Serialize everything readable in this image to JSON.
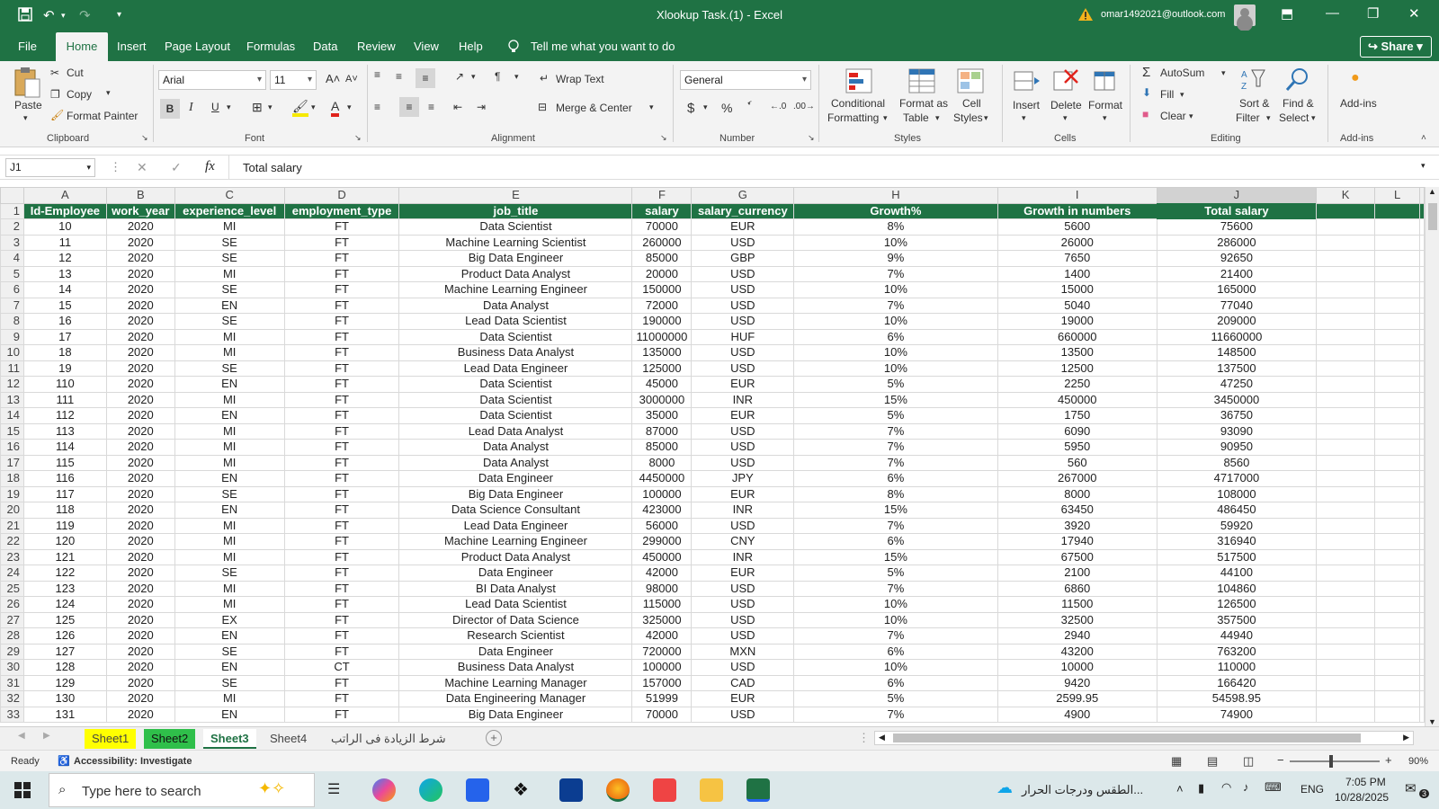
{
  "window": {
    "title": "Xlookup Task.(1)  -  Excel",
    "account": "omar1492021@outlook.com"
  },
  "menu": {
    "tabs": [
      "File",
      "Home",
      "Insert",
      "Page Layout",
      "Formulas",
      "Data",
      "Review",
      "View",
      "Help"
    ],
    "active": "Home",
    "tell_me": "Tell me what you want to do",
    "share": "Share"
  },
  "ribbon": {
    "clipboard": {
      "paste": "Paste",
      "cut": "Cut",
      "copy": "Copy",
      "format_painter": "Format Painter",
      "group": "Clipboard"
    },
    "font": {
      "name": "Arial",
      "size": "11",
      "group": "Font"
    },
    "alignment": {
      "wrap": "Wrap Text",
      "merge": "Merge & Center",
      "group": "Alignment"
    },
    "number": {
      "format": "General",
      "group": "Number",
      "currency": "$",
      "percent": "%",
      "comma": "ٗ"
    },
    "styles": {
      "conditional_1": "Conditional",
      "conditional_2": "Formatting",
      "format_table_1": "Format as",
      "format_table_2": "Table",
      "cell_styles_1": "Cell",
      "cell_styles_2": "Styles",
      "group": "Styles"
    },
    "cells": {
      "insert": "Insert",
      "delete": "Delete",
      "format": "Format",
      "group": "Cells"
    },
    "editing": {
      "autosum": "AutoSum",
      "fill": "Fill",
      "clear": "Clear",
      "sort_1": "Sort &",
      "sort_2": "Filter",
      "find_1": "Find &",
      "find_2": "Select",
      "group": "Editing"
    },
    "addins": {
      "label": "Add-ins",
      "group": "Add-ins"
    }
  },
  "formula_bar": {
    "name_box": "J1",
    "content": "Total salary",
    "fx": "fx"
  },
  "grid": {
    "columns": [
      "A",
      "B",
      "C",
      "D",
      "E",
      "F",
      "G",
      "H",
      "I",
      "J",
      "K",
      "L"
    ],
    "selected_cell": "J1",
    "header": [
      "Id-Employee",
      "work_year",
      "experience_level",
      "employment_type",
      "job_title",
      "salary",
      "salary_currency",
      "Growth%",
      "Growth in numbers",
      "Total salary"
    ],
    "rows": [
      [
        "10",
        "2020",
        "MI",
        "FT",
        "Data Scientist",
        "70000",
        "EUR",
        "8%",
        "5600",
        "75600"
      ],
      [
        "11",
        "2020",
        "SE",
        "FT",
        "Machine Learning Scientist",
        "260000",
        "USD",
        "10%",
        "26000",
        "286000"
      ],
      [
        "12",
        "2020",
        "SE",
        "FT",
        "Big Data Engineer",
        "85000",
        "GBP",
        "9%",
        "7650",
        "92650"
      ],
      [
        "13",
        "2020",
        "MI",
        "FT",
        "Product Data Analyst",
        "20000",
        "USD",
        "7%",
        "1400",
        "21400"
      ],
      [
        "14",
        "2020",
        "SE",
        "FT",
        "Machine Learning Engineer",
        "150000",
        "USD",
        "10%",
        "15000",
        "165000"
      ],
      [
        "15",
        "2020",
        "EN",
        "FT",
        "Data Analyst",
        "72000",
        "USD",
        "7%",
        "5040",
        "77040"
      ],
      [
        "16",
        "2020",
        "SE",
        "FT",
        "Lead Data Scientist",
        "190000",
        "USD",
        "10%",
        "19000",
        "209000"
      ],
      [
        "17",
        "2020",
        "MI",
        "FT",
        "Data Scientist",
        "11000000",
        "HUF",
        "6%",
        "660000",
        "11660000"
      ],
      [
        "18",
        "2020",
        "MI",
        "FT",
        "Business Data Analyst",
        "135000",
        "USD",
        "10%",
        "13500",
        "148500"
      ],
      [
        "19",
        "2020",
        "SE",
        "FT",
        "Lead Data Engineer",
        "125000",
        "USD",
        "10%",
        "12500",
        "137500"
      ],
      [
        "110",
        "2020",
        "EN",
        "FT",
        "Data Scientist",
        "45000",
        "EUR",
        "5%",
        "2250",
        "47250"
      ],
      [
        "111",
        "2020",
        "MI",
        "FT",
        "Data Scientist",
        "3000000",
        "INR",
        "15%",
        "450000",
        "3450000"
      ],
      [
        "112",
        "2020",
        "EN",
        "FT",
        "Data Scientist",
        "35000",
        "EUR",
        "5%",
        "1750",
        "36750"
      ],
      [
        "113",
        "2020",
        "MI",
        "FT",
        "Lead Data Analyst",
        "87000",
        "USD",
        "7%",
        "6090",
        "93090"
      ],
      [
        "114",
        "2020",
        "MI",
        "FT",
        "Data Analyst",
        "85000",
        "USD",
        "7%",
        "5950",
        "90950"
      ],
      [
        "115",
        "2020",
        "MI",
        "FT",
        "Data Analyst",
        "8000",
        "USD",
        "7%",
        "560",
        "8560"
      ],
      [
        "116",
        "2020",
        "EN",
        "FT",
        "Data Engineer",
        "4450000",
        "JPY",
        "6%",
        "267000",
        "4717000"
      ],
      [
        "117",
        "2020",
        "SE",
        "FT",
        "Big Data Engineer",
        "100000",
        "EUR",
        "8%",
        "8000",
        "108000"
      ],
      [
        "118",
        "2020",
        "EN",
        "FT",
        "Data Science Consultant",
        "423000",
        "INR",
        "15%",
        "63450",
        "486450"
      ],
      [
        "119",
        "2020",
        "MI",
        "FT",
        "Lead Data Engineer",
        "56000",
        "USD",
        "7%",
        "3920",
        "59920"
      ],
      [
        "120",
        "2020",
        "MI",
        "FT",
        "Machine Learning Engineer",
        "299000",
        "CNY",
        "6%",
        "17940",
        "316940"
      ],
      [
        "121",
        "2020",
        "MI",
        "FT",
        "Product Data Analyst",
        "450000",
        "INR",
        "15%",
        "67500",
        "517500"
      ],
      [
        "122",
        "2020",
        "SE",
        "FT",
        "Data Engineer",
        "42000",
        "EUR",
        "5%",
        "2100",
        "44100"
      ],
      [
        "123",
        "2020",
        "MI",
        "FT",
        "BI Data Analyst",
        "98000",
        "USD",
        "7%",
        "6860",
        "104860"
      ],
      [
        "124",
        "2020",
        "MI",
        "FT",
        "Lead Data Scientist",
        "115000",
        "USD",
        "10%",
        "11500",
        "126500"
      ],
      [
        "125",
        "2020",
        "EX",
        "FT",
        "Director of Data Science",
        "325000",
        "USD",
        "10%",
        "32500",
        "357500"
      ],
      [
        "126",
        "2020",
        "EN",
        "FT",
        "Research Scientist",
        "42000",
        "USD",
        "7%",
        "2940",
        "44940"
      ],
      [
        "127",
        "2020",
        "SE",
        "FT",
        "Data Engineer",
        "720000",
        "MXN",
        "6%",
        "43200",
        "763200"
      ],
      [
        "128",
        "2020",
        "EN",
        "CT",
        "Business Data Analyst",
        "100000",
        "USD",
        "10%",
        "10000",
        "110000"
      ],
      [
        "129",
        "2020",
        "SE",
        "FT",
        "Machine Learning Manager",
        "157000",
        "CAD",
        "6%",
        "9420",
        "166420"
      ],
      [
        "130",
        "2020",
        "MI",
        "FT",
        "Data Engineering Manager",
        "51999",
        "EUR",
        "5%",
        "2599.95",
        "54598.95"
      ],
      [
        "131",
        "2020",
        "EN",
        "FT",
        "Big Data Engineer",
        "70000",
        "USD",
        "7%",
        "4900",
        "74900"
      ]
    ]
  },
  "sheets": {
    "tabs": [
      "Sheet1",
      "Sheet2",
      "Sheet3",
      "Sheet4",
      "شرط الزيادة فى الراتب"
    ],
    "active": "Sheet3",
    "colors": {
      "Sheet1": "#ffff00",
      "Sheet2": "#2fbf4a"
    }
  },
  "status": {
    "ready": "Ready",
    "accessibility": "Accessibility: Investigate",
    "zoom": "90%"
  },
  "taskbar": {
    "search_placeholder": "Type here to search",
    "weather": "الطقس ودرجات الحرار...",
    "language": "ENG",
    "time": "7:05 PM",
    "date": "10/28/2025",
    "notifications": "3"
  }
}
